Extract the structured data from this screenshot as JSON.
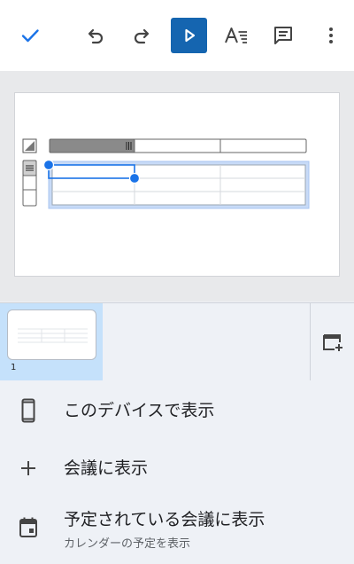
{
  "toolbar": {
    "icons": [
      "check-icon",
      "undo-icon",
      "redo-icon",
      "play-icon",
      "text-format-icon",
      "comment-icon",
      "more-vert-icon"
    ],
    "accent_color": "#1565b0"
  },
  "filmstrip": {
    "slides": [
      {
        "number": "1",
        "selected": true
      }
    ],
    "selected_color": "#c5e1fb"
  },
  "menu": {
    "items": [
      {
        "icon": "phone-icon",
        "label": "このデバイスで表示"
      },
      {
        "icon": "plus-icon",
        "label": "会議に表示"
      },
      {
        "icon": "calendar-icon",
        "label": "予定されている会議に表示",
        "sublabel": "カレンダーの予定を表示"
      }
    ]
  }
}
